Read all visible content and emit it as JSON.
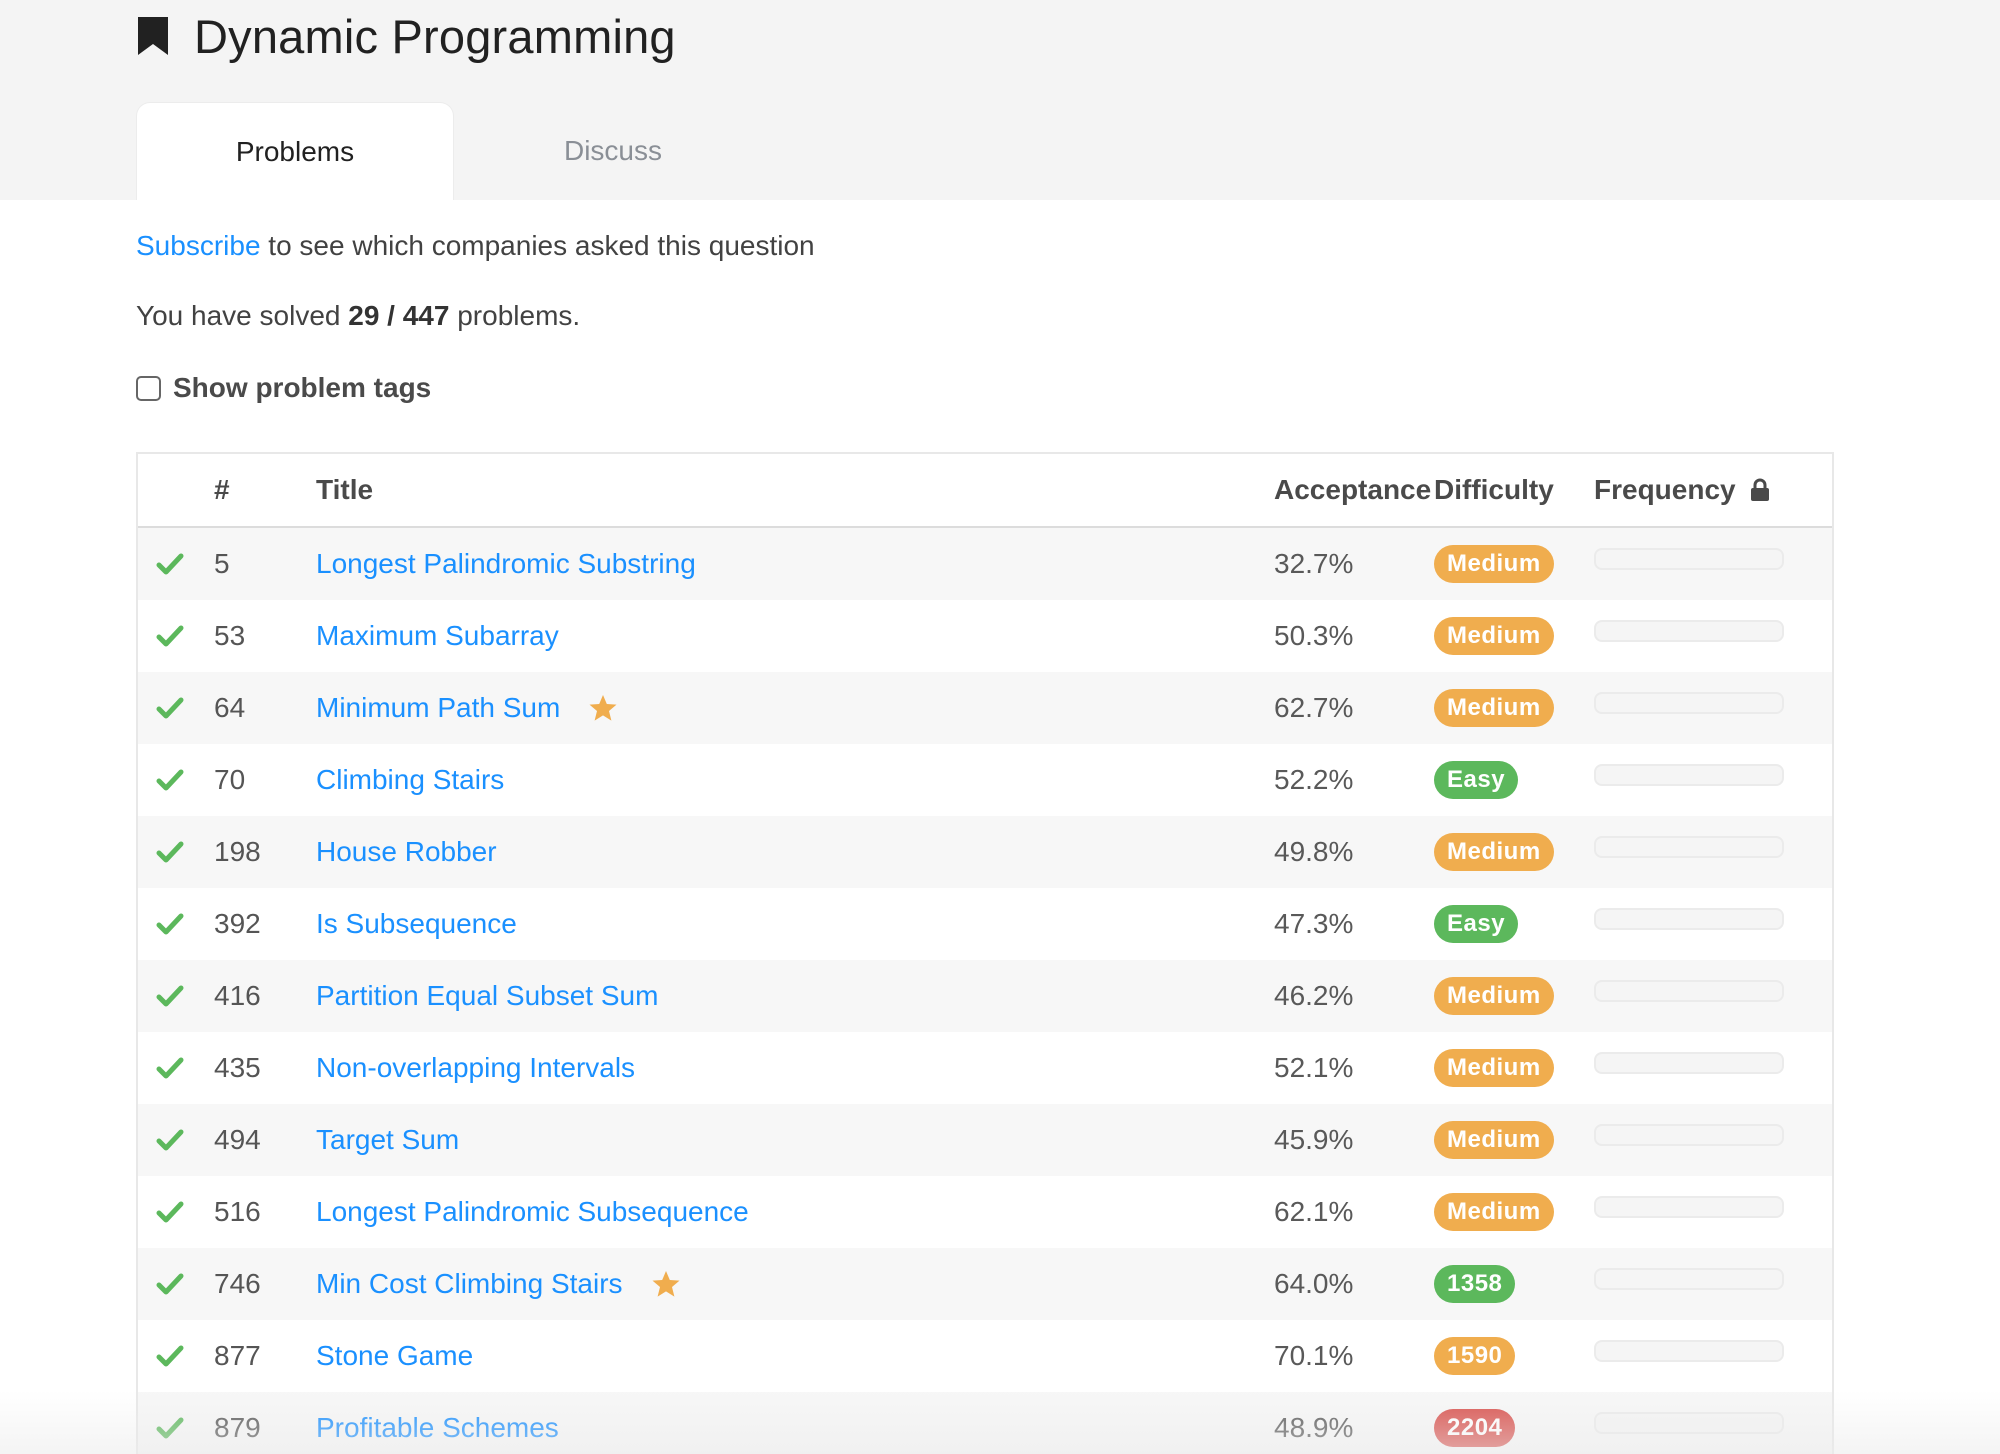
{
  "page": {
    "title": "Dynamic Programming",
    "bookmark_icon": "bookmark-icon"
  },
  "tabs": [
    {
      "label": "Problems",
      "active": true
    },
    {
      "label": "Discuss",
      "active": false
    }
  ],
  "subscribe": {
    "link": "Subscribe",
    "text": " to see which companies asked this question"
  },
  "solved": {
    "prefix": "You have solved ",
    "count": "29 / 447",
    "suffix": " problems."
  },
  "show_tags": {
    "label": "Show problem tags",
    "checked": false
  },
  "table": {
    "headers": {
      "num": "#",
      "title": "Title",
      "acceptance": "Acceptance",
      "difficulty": "Difficulty",
      "frequency": "Frequency",
      "frequency_icon": "lock-icon"
    },
    "rows": [
      {
        "solved": true,
        "num": "5",
        "title": "Longest Palindromic Substring",
        "starred": false,
        "acceptance": "32.7%",
        "difficulty": "Medium",
        "color": "#f0ad4e",
        "frequency": 0
      },
      {
        "solved": true,
        "num": "53",
        "title": "Maximum Subarray",
        "starred": false,
        "acceptance": "50.3%",
        "difficulty": "Medium",
        "color": "#f0ad4e",
        "frequency": 0
      },
      {
        "solved": true,
        "num": "64",
        "title": "Minimum Path Sum",
        "starred": true,
        "acceptance": "62.7%",
        "difficulty": "Medium",
        "color": "#f0ad4e",
        "frequency": 0
      },
      {
        "solved": true,
        "num": "70",
        "title": "Climbing Stairs",
        "starred": false,
        "acceptance": "52.2%",
        "difficulty": "Easy",
        "color": "#5cb85c",
        "frequency": 0
      },
      {
        "solved": true,
        "num": "198",
        "title": "House Robber",
        "starred": false,
        "acceptance": "49.8%",
        "difficulty": "Medium",
        "color": "#f0ad4e",
        "frequency": 0
      },
      {
        "solved": true,
        "num": "392",
        "title": "Is Subsequence",
        "starred": false,
        "acceptance": "47.3%",
        "difficulty": "Easy",
        "color": "#5cb85c",
        "frequency": 0
      },
      {
        "solved": true,
        "num": "416",
        "title": "Partition Equal Subset Sum",
        "starred": false,
        "acceptance": "46.2%",
        "difficulty": "Medium",
        "color": "#f0ad4e",
        "frequency": 0
      },
      {
        "solved": true,
        "num": "435",
        "title": "Non-overlapping Intervals",
        "starred": false,
        "acceptance": "52.1%",
        "difficulty": "Medium",
        "color": "#f0ad4e",
        "frequency": 0
      },
      {
        "solved": true,
        "num": "494",
        "title": "Target Sum",
        "starred": false,
        "acceptance": "45.9%",
        "difficulty": "Medium",
        "color": "#f0ad4e",
        "frequency": 0
      },
      {
        "solved": true,
        "num": "516",
        "title": "Longest Palindromic Subsequence",
        "starred": false,
        "acceptance": "62.1%",
        "difficulty": "Medium",
        "color": "#f0ad4e",
        "frequency": 0
      },
      {
        "solved": true,
        "num": "746",
        "title": "Min Cost Climbing Stairs",
        "starred": true,
        "acceptance": "64.0%",
        "difficulty": "1358",
        "color": "#5cb85c",
        "frequency": 0
      },
      {
        "solved": true,
        "num": "877",
        "title": "Stone Game",
        "starred": false,
        "acceptance": "70.1%",
        "difficulty": "1590",
        "color": "#f0ad4e",
        "frequency": 0
      },
      {
        "solved": true,
        "num": "879",
        "title": "Profitable Schemes",
        "starred": false,
        "acceptance": "48.9%",
        "difficulty": "2204",
        "color": "#d9534f",
        "frequency": 0
      }
    ]
  },
  "colors": {
    "link": "#1a90ff",
    "check": "#5cb85c",
    "star": "#f0ad4e"
  }
}
